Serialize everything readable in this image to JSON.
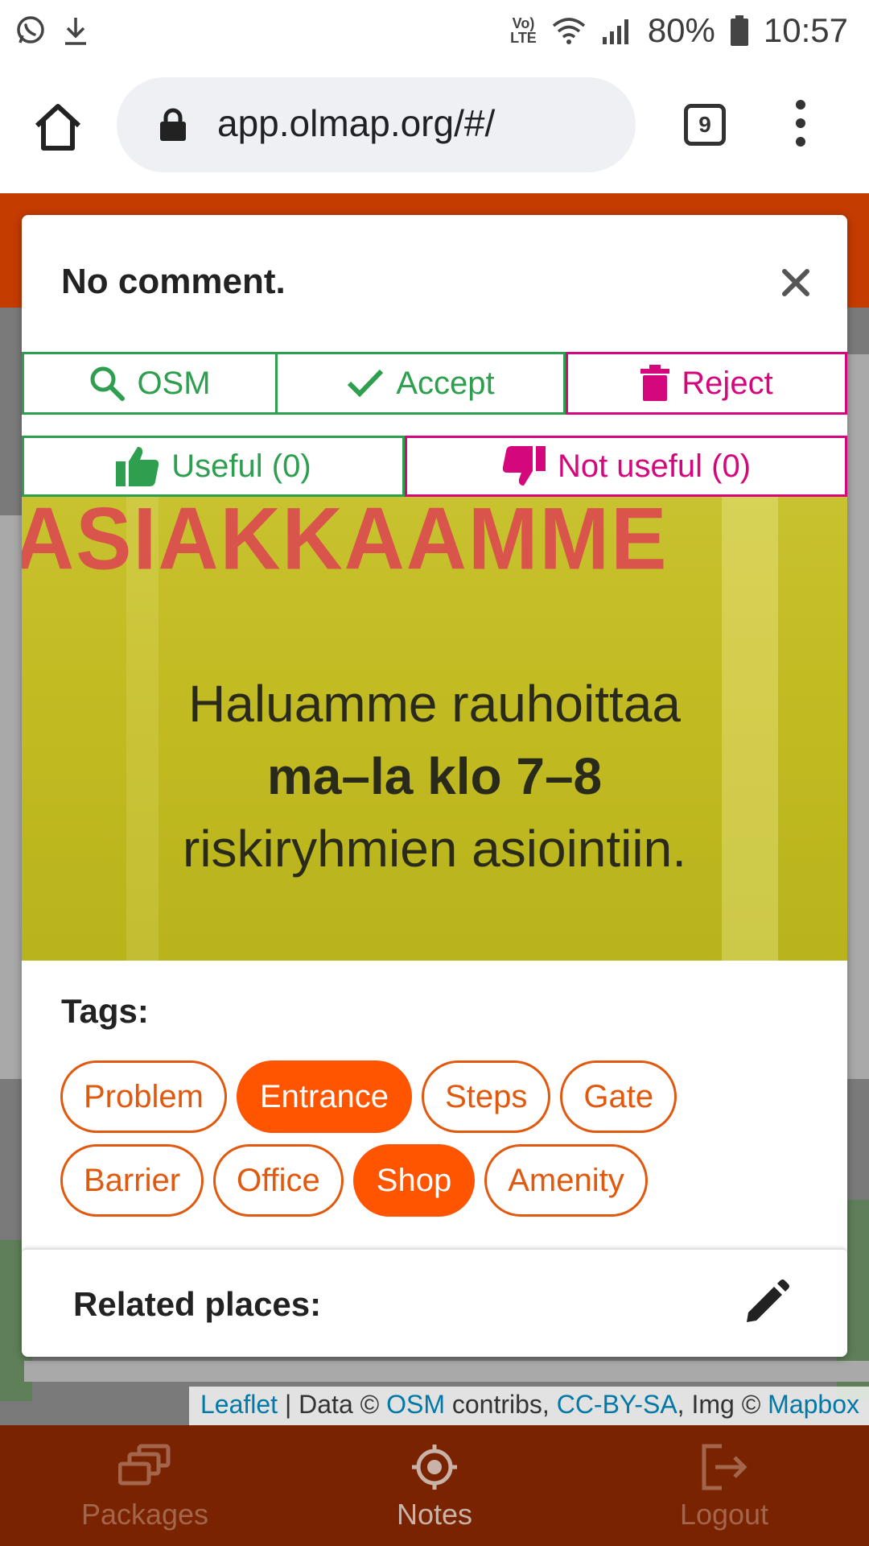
{
  "status_bar": {
    "lte_top": "Vo)",
    "lte_bottom": "LTE",
    "battery": "80%",
    "time": "10:57"
  },
  "browser": {
    "url": "app.olmap.org/#/",
    "tab_count": "9"
  },
  "modal": {
    "title": "No comment.",
    "actions": {
      "osm": "OSM",
      "accept": "Accept",
      "reject": "Reject",
      "useful": "Useful (0)",
      "not_useful": "Not useful (0)"
    },
    "photo_text": {
      "headline": "ASIAKKAAMME",
      "line1": "Haluamme rauhoittaa",
      "line2": "ma–la klo 7–8",
      "line3": "riskiryhmien asiointiin."
    },
    "tags_title": "Tags:",
    "tags": [
      {
        "label": "Problem",
        "selected": false
      },
      {
        "label": "Entrance",
        "selected": true
      },
      {
        "label": "Steps",
        "selected": false
      },
      {
        "label": "Gate",
        "selected": false
      },
      {
        "label": "Barrier",
        "selected": false
      },
      {
        "label": "Office",
        "selected": false
      },
      {
        "label": "Shop",
        "selected": true
      },
      {
        "label": "Amenity",
        "selected": false
      }
    ],
    "related_title": "Related places:"
  },
  "attribution": {
    "leaflet": "Leaflet",
    "data_prefix": "| Data ©",
    "osm": "OSM",
    "contribs": "contribs,",
    "license": "CC-BY-SA",
    "img_prefix": ", Img ©",
    "mapbox": "Mapbox"
  },
  "bottom_nav": {
    "packages": "Packages",
    "notes": "Notes",
    "logout": "Logout"
  },
  "colors": {
    "accent_orange": "#ff5500",
    "accept_green": "#2e9e4f",
    "reject_pink": "#d4087c",
    "header_red": "#c43c00",
    "nav_bg": "#7a2300"
  }
}
